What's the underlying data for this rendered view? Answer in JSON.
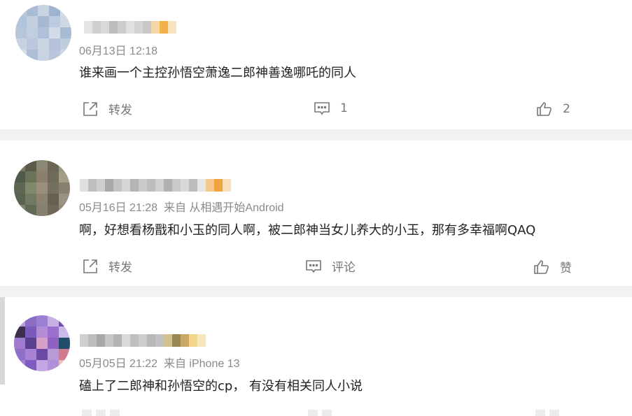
{
  "comments": [
    {
      "time": "06月13日 12:18",
      "source": "",
      "text": "谁来画一个主控孙悟空萧逸二郎神善逸哪吒的同人",
      "actions": {
        "repost": "转发",
        "comment": "1",
        "like": "2"
      },
      "colors": {
        "avatar": [
          "#b9c6d6",
          "#a9bcd4",
          "#c7d3e1",
          "#9db3cf",
          "#d6dde8",
          "#b2c4dc",
          "#c3cfe0",
          "#a6b9d1",
          "#bccbe0",
          "#cfd9e6",
          "#b7c5d9",
          "#c1cee0",
          "#b0c0d8",
          "#d2dbe7",
          "#a9bbd5",
          "#c6d1e2",
          "#bac7dc",
          "#cbd6e4",
          "#b4c3d9",
          "#c0cddf",
          "#d4dce8",
          "#adbed5",
          "#c8d3e3",
          "#b7c6db",
          "#cdd7e5"
        ]
      }
    },
    {
      "time": "05月16日 21:28",
      "source": "来自 从相遇开始Android",
      "text": "啊，好想看杨戬和小玉的同人啊，被二郎神当女儿养大的小玉，那有多幸福啊QAQ",
      "actions": {
        "repost": "转发",
        "comment": "评论",
        "like": "赞"
      },
      "colors": {
        "avatar": [
          "#7c7866",
          "#5c5a4a",
          "#8a8772",
          "#6b6656",
          "#9a9580",
          "#4f5a4a",
          "#6a7257",
          "#8b7e6b",
          "#706a5a",
          "#a59d88",
          "#5d6651",
          "#7f8a6c",
          "#9b8f7b",
          "#756f5f",
          "#888170",
          "#5a6350",
          "#6f7a60",
          "#8c8270",
          "#656050",
          "#9a9382",
          "#7b8670",
          "#5f6a55",
          "#86806e",
          "#6e6858",
          "#948c7a"
        ]
      }
    },
    {
      "time": "05月05日 21:22",
      "source": "来自 iPhone 13",
      "text": "磕上了二郎神和孙悟空的cp， 有没有相关同人小说",
      "actions": {
        "repost": "转发",
        "comment": "评论",
        "like": "赞"
      },
      "colors": {
        "avatar": [
          "#b59ad8",
          "#8a6cc4",
          "#9d7fd2",
          "#c7b0e6",
          "#6f52a8",
          "#3b2f4e",
          "#7a5bbd",
          "#b38cd6",
          "#9c6fcf",
          "#cdb8ea",
          "#a07ad0",
          "#5b3f8f",
          "#d5a0c8",
          "#8f62c2",
          "#1f4d6b",
          "#8d6fc6",
          "#a883d4",
          "#6a4aa5",
          "#b99ad9",
          "#d07a8f",
          "#9f80d1",
          "#7c5cbf",
          "#c4a6e2",
          "#b090d8",
          "#e8c0b8"
        ]
      }
    }
  ],
  "name_colors": {
    "c1": [
      "#e4e4e4",
      "#cfcfcf",
      "#d9d9d9",
      "#bdbdbd",
      "#cccccc",
      "#e0e0e0",
      "#d4d4d4",
      "#c8c8c8",
      "#f5d6a8",
      "#f0b04a",
      "#f7e3c0"
    ],
    "c2": [
      "#e0e0e0",
      "#bfbfbf",
      "#cfcfcf",
      "#a9a9a9",
      "#c4c4c4",
      "#d6d6d6",
      "#b5b5b5",
      "#cacaca",
      "#bdbdbd",
      "#d0d0d0",
      "#b0b0b0",
      "#c9c9c9",
      "#d8d8d8",
      "#bcbcbc",
      "#e6e6e6",
      "#f5c98c",
      "#f0a341",
      "#f8e0bc"
    ],
    "c3": [
      "#cfcfcf",
      "#bdbdbd",
      "#a7a7a7",
      "#c6c6c6",
      "#b3b3b3",
      "#d9d9d9",
      "#bfbfbf",
      "#cccccc",
      "#b8b8b8",
      "#c2c2c2",
      "#d2c08f",
      "#9a8756",
      "#c9a866",
      "#f3d58b",
      "#f6e7b9"
    ]
  }
}
